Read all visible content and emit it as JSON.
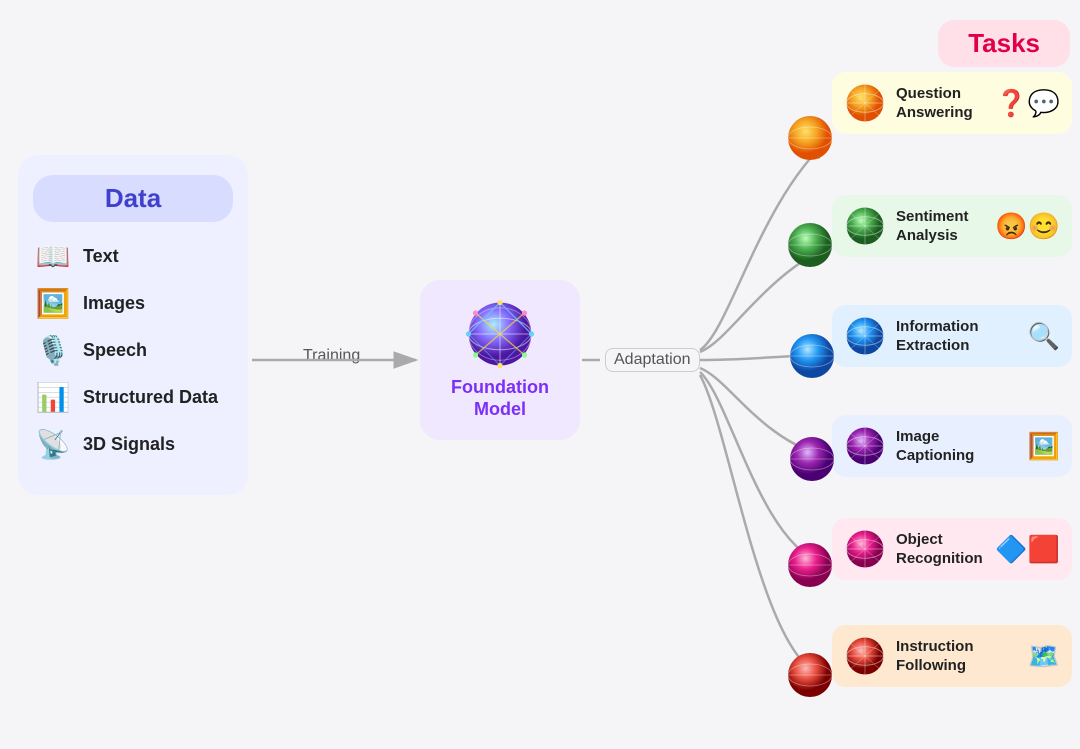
{
  "data_panel": {
    "title": "Data",
    "items": [
      {
        "label": "Text",
        "icon": "📖"
      },
      {
        "label": "Images",
        "icon": "🖼️"
      },
      {
        "label": "Speech",
        "icon": "🎙️"
      },
      {
        "label": "Structured Data",
        "icon": "📊"
      },
      {
        "label": "3D Signals",
        "icon": "📡"
      }
    ]
  },
  "training_label": "Training",
  "adaptation_label": "Adaptation",
  "foundation_label": "Foundation\nModel",
  "tasks_title": "Tasks",
  "tasks": [
    {
      "label": "Question\nAnswering",
      "emoji": "❓💬",
      "globe_color": "#f5a623",
      "card_class": "card-qa"
    },
    {
      "label": "Sentiment\nAnalysis",
      "emoji": "😊😡",
      "globe_color": "#7ed321",
      "card_class": "card-sa"
    },
    {
      "label": "Information\nExtraction",
      "emoji": "🔍",
      "globe_color": "#4a90d9",
      "card_class": "card-ie"
    },
    {
      "label": "Image\nCaptioning",
      "emoji": "🖼️",
      "globe_color": "#9b59b6",
      "card_class": "card-ic"
    },
    {
      "label": "Object\nRecognition",
      "emoji": "🔷🟥",
      "globe_color": "#e91e8c",
      "card_class": "card-or"
    },
    {
      "label": "Instruction\nFollowing",
      "emoji": "🗺️",
      "globe_color": "#e74c3c",
      "card_class": "card-if"
    }
  ]
}
